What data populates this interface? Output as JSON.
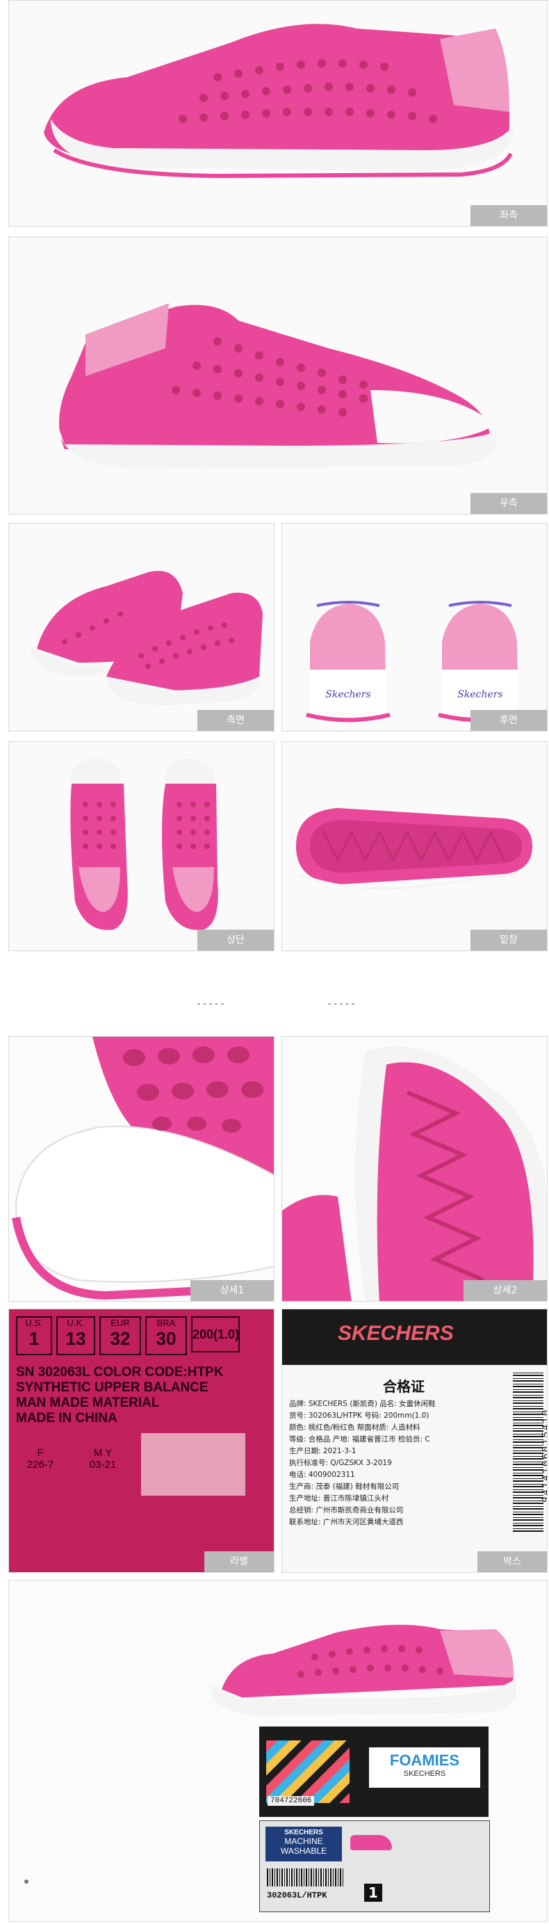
{
  "labels": {
    "left": "좌측",
    "right": "우측",
    "side": "측면",
    "back": "후면",
    "top": "상단",
    "sole": "밑창",
    "detail1": "상세1",
    "detail2": "상세2",
    "label": "라벨",
    "box": "박스"
  },
  "separators": [
    "-----",
    "-----"
  ],
  "label_panel": {
    "headers": [
      "U.S.",
      "U.K.",
      "EUR",
      "BRA"
    ],
    "values": [
      "1",
      "13",
      "32",
      "30",
      "200(1.0)"
    ],
    "lines": [
      "SN 302063L COLOR CODE:HTPK",
      "SYNTHETIC UPPER BALANCE",
      "MAN MADE MATERIAL",
      "MADE IN CHINA"
    ],
    "footer_f": "F",
    "footer_f_val": "226-7",
    "footer_my": "M  Y",
    "footer_my_val": "03-21"
  },
  "box_panel": {
    "brand": "SKECHERS",
    "title": "合格证",
    "rows": [
      "品牌: SKECHERS (斯凯奇)   品名: 女童休闲鞋",
      "货号: 302063L/HTPK   号码: 200mm(1.0)",
      "颜色: 桃红色/粉红色   帮面材质: 人造材料",
      "等级: 合格品   产地: 福建省晋江市   检验员: C",
      "生产日期: 2021-3-1",
      "执行标准号: Q/GZSKX 3-2019",
      "电话: 4009002311",
      "生产商: 茂泰 (福建) 鞋材有限公司",
      "生产地址: 晋江市陈埭镇江头村",
      "总经销: 广州市斯凯奇商业有限公司",
      "联系地址: 广州市天河区黄埔大道西"
    ],
    "barcode_text": "9414106015410"
  },
  "stack_panel": {
    "box_upc": "704722606",
    "foamies_brand": "FOAMIES",
    "foamies_sub": "SKECHERS",
    "wash_title": "SKECHERS",
    "wash_line1": "MACHINE",
    "wash_line2": "WASHABLE",
    "box_code": "302063L/HTPK",
    "box_size": "1"
  },
  "colors": {
    "pink": "#e8479a",
    "pink_dark": "#c2306f",
    "white_sole": "#f4f4f4",
    "tag_gray": "#b9b9b9"
  }
}
